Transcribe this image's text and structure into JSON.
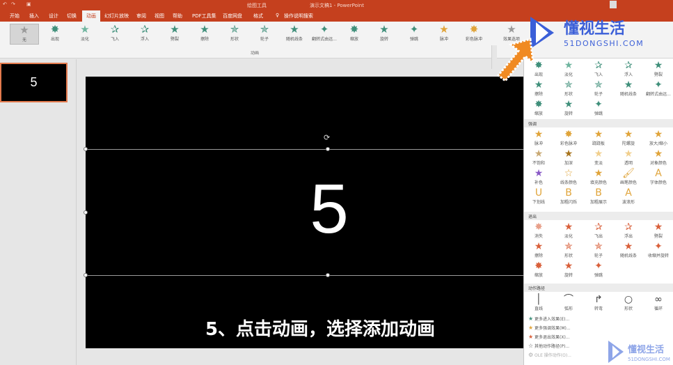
{
  "titlebar": {
    "tools_label": "绘图工具",
    "doc_title": "演示文稿1 - PowerPoint"
  },
  "tabs": [
    "开始",
    "插入",
    "设计",
    "切换",
    "动画",
    "幻灯片放映",
    "审阅",
    "视图",
    "帮助",
    "PDF工具集",
    "百度网盘",
    "格式"
  ],
  "tab_active": "动画",
  "search_hint": "操作说明搜索",
  "ribbon": {
    "gallery": [
      {
        "label": "无",
        "color": "#9a9a9a"
      },
      {
        "label": "出现",
        "color": "#3f8f7a"
      },
      {
        "label": "淡化",
        "color": "#6fb59f"
      },
      {
        "label": "飞入",
        "color": "#3f8f7a"
      },
      {
        "label": "浮入",
        "color": "#3f8f7a"
      },
      {
        "label": "劈裂",
        "color": "#3f8f7a"
      },
      {
        "label": "擦除",
        "color": "#3f8f7a"
      },
      {
        "label": "形状",
        "color": "#3f8f7a"
      },
      {
        "label": "轮子",
        "color": "#3f8f7a"
      },
      {
        "label": "随机线条",
        "color": "#3f8f7a"
      },
      {
        "label": "翻转式由远...",
        "color": "#3f8f7a"
      },
      {
        "label": "缩放",
        "color": "#3f8f7a"
      },
      {
        "label": "旋转",
        "color": "#3f8f7a"
      },
      {
        "label": "弹跳",
        "color": "#3f8f7a"
      },
      {
        "label": "脉冲",
        "color": "#e0a43a"
      },
      {
        "label": "彩色脉冲",
        "color": "#e0a43a"
      }
    ],
    "effect_options": "效果选项",
    "group_label": "动画"
  },
  "thumbnail_text": "5",
  "slide": {
    "number": "5",
    "caption": "5、点击动画，选择添加动画"
  },
  "dropdown": {
    "sections": [
      {
        "title": "",
        "items": [
          "出现",
          "淡化",
          "飞入",
          "浮入",
          "劈裂",
          "擦除",
          "形状",
          "轮子",
          "随机线条",
          "翻转式由远...",
          "缩放",
          "旋转",
          "弹跳"
        ],
        "color": "#3f8f7a"
      },
      {
        "title": "强调",
        "items": [
          "脉冲",
          "彩色脉冲",
          "跷跷板",
          "陀螺旋",
          "放大/缩小",
          "不饱和",
          "加深",
          "变淡",
          "透明",
          "对象颜色",
          "补色",
          "线条颜色",
          "填充颜色",
          "画笔颜色",
          "字体颜色",
          "下划线",
          "加粗闪烁",
          "加粗展示",
          "波浪形"
        ],
        "color": "#e0a43a"
      },
      {
        "title": "退出",
        "items": [
          "消失",
          "淡化",
          "飞出",
          "浮出",
          "劈裂",
          "擦除",
          "形状",
          "轮子",
          "随机线条",
          "收缩并旋转",
          "缩放",
          "旋转",
          "弹跳"
        ],
        "color": "#d9603b"
      },
      {
        "title": "动作路径",
        "items": [
          "直线",
          "弧形",
          "转弯",
          "形状",
          "循环"
        ],
        "color": "#444444"
      }
    ],
    "more": [
      {
        "label": "更多进入效果(E)...",
        "color": "#3f8f7a"
      },
      {
        "label": "更多强调效果(M)...",
        "color": "#e0a43a"
      },
      {
        "label": "更多退出效果(X)...",
        "color": "#d9603b"
      },
      {
        "label": "其他动作路径(P)...",
        "color": "#555555"
      },
      {
        "label": "OLE 操作动作(O)...",
        "color": "#aaaaaa"
      }
    ]
  },
  "watermark": {
    "brand_cn": "懂视生活",
    "brand_en": "51DONGSHI.COM",
    "brand_color": "#3b5fd8"
  }
}
